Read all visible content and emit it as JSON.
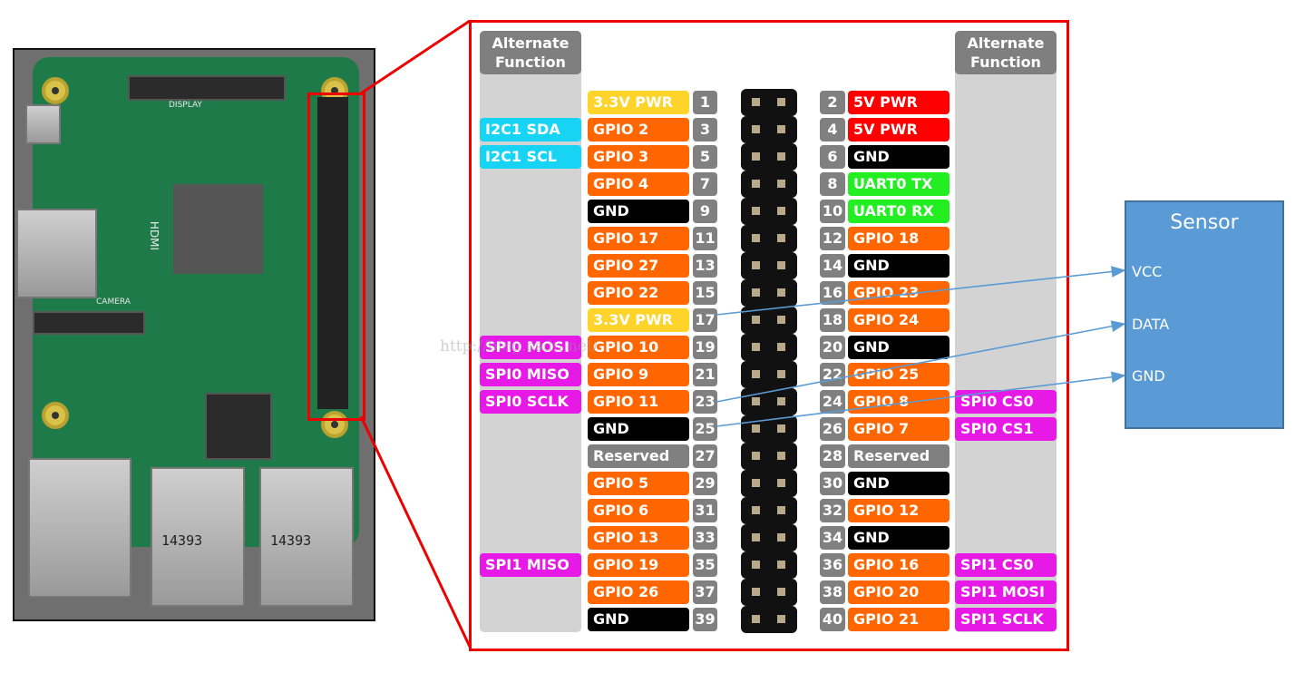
{
  "photo": {
    "hdmi": "HDMI",
    "display": "DISPLAY",
    "camera": "CAMERA",
    "usb1": "14393",
    "usb2": "14393"
  },
  "panel": {
    "alt_header_left": "Alternate Function",
    "alt_header_right": "Alternate Function"
  },
  "colors": {
    "power33": "#ffd42a",
    "power5": "#ff0000",
    "gpio": "#ff6600",
    "gnd": "#000000",
    "uart": "#22ee22",
    "reserved": "#808080",
    "i2c": "#17d4f5",
    "spi": "#e619e6",
    "pin_number": "#808080",
    "sensor": "#5b9bd5",
    "wire": "#5b9bd5",
    "callout": "#ee0000"
  },
  "rows": [
    {
      "l_alt": "",
      "l": "3.3V PWR",
      "lc": "power33",
      "ln": "1",
      "rn": "2",
      "r": "5V PWR",
      "rc": "power5",
      "r_alt": ""
    },
    {
      "l_alt": "I2C1 SDA",
      "l": "GPIO 2",
      "lc": "gpio",
      "ln": "3",
      "rn": "4",
      "r": "5V PWR",
      "rc": "power5",
      "r_alt": ""
    },
    {
      "l_alt": "I2C1 SCL",
      "l": "GPIO 3",
      "lc": "gpio",
      "ln": "5",
      "rn": "6",
      "r": "GND",
      "rc": "gnd",
      "r_alt": ""
    },
    {
      "l_alt": "",
      "l": "GPIO 4",
      "lc": "gpio",
      "ln": "7",
      "rn": "8",
      "r": "UART0 TX",
      "rc": "uart",
      "r_alt": ""
    },
    {
      "l_alt": "",
      "l": "GND",
      "lc": "gnd",
      "ln": "9",
      "rn": "10",
      "r": "UART0 RX",
      "rc": "uart",
      "r_alt": ""
    },
    {
      "l_alt": "",
      "l": "GPIO 17",
      "lc": "gpio",
      "ln": "11",
      "rn": "12",
      "r": "GPIO 18",
      "rc": "gpio",
      "r_alt": ""
    },
    {
      "l_alt": "",
      "l": "GPIO 27",
      "lc": "gpio",
      "ln": "13",
      "rn": "14",
      "r": "GND",
      "rc": "gnd",
      "r_alt": ""
    },
    {
      "l_alt": "",
      "l": "GPIO 22",
      "lc": "gpio",
      "ln": "15",
      "rn": "16",
      "r": "GPIO 23",
      "rc": "gpio",
      "r_alt": ""
    },
    {
      "l_alt": "",
      "l": "3.3V PWR",
      "lc": "power33",
      "ln": "17",
      "rn": "18",
      "r": "GPIO 24",
      "rc": "gpio",
      "r_alt": ""
    },
    {
      "l_alt": "SPI0 MOSI",
      "l": "GPIO 10",
      "lc": "gpio",
      "ln": "19",
      "rn": "20",
      "r": "GND",
      "rc": "gnd",
      "r_alt": ""
    },
    {
      "l_alt": "SPI0 MISO",
      "l": "GPIO 9",
      "lc": "gpio",
      "ln": "21",
      "rn": "22",
      "r": "GPIO 25",
      "rc": "gpio",
      "r_alt": ""
    },
    {
      "l_alt": "SPI0 SCLK",
      "l": "GPIO 11",
      "lc": "gpio",
      "ln": "23",
      "rn": "24",
      "r": "GPIO 8",
      "rc": "gpio",
      "r_alt": "SPI0 CS0"
    },
    {
      "l_alt": "",
      "l": "GND",
      "lc": "gnd",
      "ln": "25",
      "rn": "26",
      "r": "GPIO 7",
      "rc": "gpio",
      "r_alt": "SPI0 CS1"
    },
    {
      "l_alt": "",
      "l": "Reserved",
      "lc": "reserved",
      "ln": "27",
      "rn": "28",
      "r": "Reserved",
      "rc": "reserved",
      "r_alt": ""
    },
    {
      "l_alt": "",
      "l": "GPIO 5",
      "lc": "gpio",
      "ln": "29",
      "rn": "30",
      "r": "GND",
      "rc": "gnd",
      "r_alt": ""
    },
    {
      "l_alt": "",
      "l": "GPIO 6",
      "lc": "gpio",
      "ln": "31",
      "rn": "32",
      "r": "GPIO 12",
      "rc": "gpio",
      "r_alt": ""
    },
    {
      "l_alt": "",
      "l": "GPIO 13",
      "lc": "gpio",
      "ln": "33",
      "rn": "34",
      "r": "GND",
      "rc": "gnd",
      "r_alt": ""
    },
    {
      "l_alt": "SPI1 MISO",
      "l": "GPIO 19",
      "lc": "gpio",
      "ln": "35",
      "rn": "36",
      "r": "GPIO 16",
      "rc": "gpio",
      "r_alt": "SPI1 CS0"
    },
    {
      "l_alt": "",
      "l": "GPIO 26",
      "lc": "gpio",
      "ln": "37",
      "rn": "38",
      "r": "GPIO 20",
      "rc": "gpio",
      "r_alt": "SPI1 MOSI"
    },
    {
      "l_alt": "",
      "l": "GND",
      "lc": "gnd",
      "ln": "39",
      "rn": "40",
      "r": "GPIO 21",
      "rc": "gpio",
      "r_alt": "SPI1 SCLK"
    }
  ],
  "sensor": {
    "title": "Sensor",
    "pins": [
      "VCC",
      "DATA",
      "GND"
    ]
  },
  "connections": [
    {
      "from_pin": "17",
      "to": "VCC"
    },
    {
      "from_pin": "23",
      "to": "DATA"
    },
    {
      "from_pin": "25",
      "to": "GND"
    }
  ],
  "watermark": "http://blog.csdn.net/"
}
